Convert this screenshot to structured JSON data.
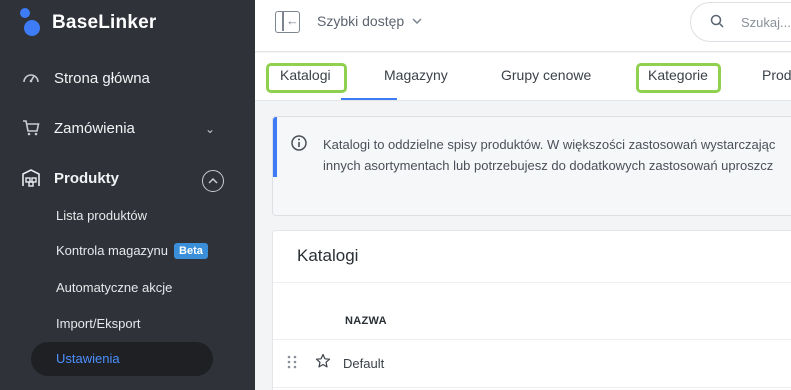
{
  "app": {
    "name": "BaseLinker"
  },
  "sidebar": {
    "items": [
      {
        "label": "Strona główna",
        "icon": "dashboard-icon"
      },
      {
        "label": "Zamówienia",
        "icon": "cart-icon",
        "chevron": "chevron-down-icon"
      },
      {
        "label": "Produkty",
        "icon": "warehouse-icon",
        "chevron": "chevron-up-icon"
      }
    ],
    "subitems": [
      {
        "label": "Lista produktów"
      },
      {
        "label": "Kontrola magazynu",
        "badge": "Beta"
      },
      {
        "label": "Automatyczne akcje"
      },
      {
        "label": "Import/Eksport"
      },
      {
        "label": "Ustawienia",
        "active": true
      }
    ]
  },
  "header": {
    "quick_access": "Szybki dostęp",
    "search_placeholder": "Szukaj..."
  },
  "tabs": [
    {
      "label": "Katalogi",
      "active": true,
      "highlighted": true
    },
    {
      "label": "Magazyny"
    },
    {
      "label": "Grupy cenowe"
    },
    {
      "label": "Kategorie",
      "highlighted": true
    },
    {
      "label": "Prod"
    }
  ],
  "info": {
    "line1": "Katalogi to oddzielne spisy produktów. W większości zastosowań wystarczając",
    "line2": "innych asortymentach lub potrzebujesz do dodatkowych zastosowań uproszcz"
  },
  "catalogs": {
    "title": "Katalogi",
    "column_name": "NAZWA",
    "rows": [
      {
        "name": "Default"
      }
    ]
  },
  "colors": {
    "sidebar_bg": "#2f3238",
    "accent": "#3d7bf7",
    "highlight": "#8fd14f",
    "beta_badge": "#3a8fd8"
  }
}
